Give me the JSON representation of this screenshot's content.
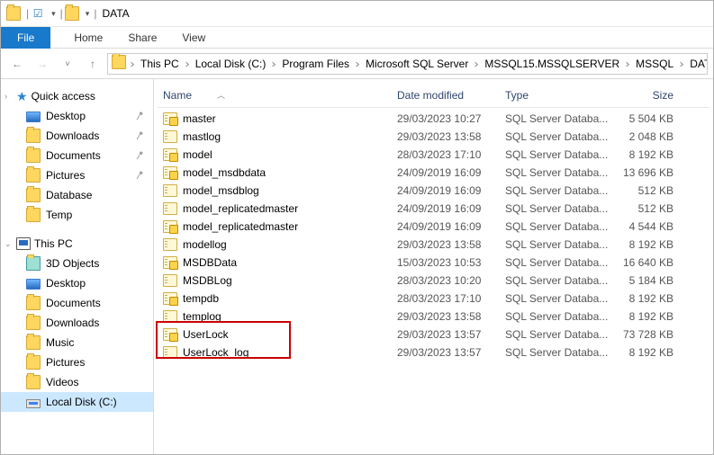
{
  "titlebar": {
    "title": "DATA"
  },
  "ribbon": {
    "file": "File",
    "tabs": [
      "Home",
      "Share",
      "View"
    ]
  },
  "breadcrumb": [
    "This PC",
    "Local Disk (C:)",
    "Program Files",
    "Microsoft SQL Server",
    "MSSQL15.MSSQLSERVER",
    "MSSQL",
    "DATA"
  ],
  "sidebar": {
    "quick": {
      "label": "Quick access"
    },
    "quick_items": [
      {
        "label": "Desktop",
        "pin": true,
        "icon": "desktop"
      },
      {
        "label": "Downloads",
        "pin": true,
        "icon": "folder"
      },
      {
        "label": "Documents",
        "pin": true,
        "icon": "folder"
      },
      {
        "label": "Pictures",
        "pin": true,
        "icon": "folder"
      },
      {
        "label": "Database",
        "pin": false,
        "icon": "folder"
      },
      {
        "label": "Temp",
        "pin": false,
        "icon": "folder"
      }
    ],
    "thispc": {
      "label": "This PC"
    },
    "pc_items": [
      {
        "label": "3D Objects",
        "icon": "folder3d"
      },
      {
        "label": "Desktop",
        "icon": "desktop"
      },
      {
        "label": "Documents",
        "icon": "folder"
      },
      {
        "label": "Downloads",
        "icon": "folder"
      },
      {
        "label": "Music",
        "icon": "folder"
      },
      {
        "label": "Pictures",
        "icon": "folder"
      },
      {
        "label": "Videos",
        "icon": "folder"
      },
      {
        "label": "Local Disk (C:)",
        "icon": "drive",
        "selected": true
      }
    ]
  },
  "columns": {
    "name": "Name",
    "date": "Date modified",
    "type": "Type",
    "size": "Size"
  },
  "files": [
    {
      "name": "master",
      "date": "29/03/2023 10:27",
      "type": "SQL Server Databa...",
      "size": "5 504 KB",
      "primary": true
    },
    {
      "name": "mastlog",
      "date": "29/03/2023 13:58",
      "type": "SQL Server Databa...",
      "size": "2 048 KB",
      "primary": false
    },
    {
      "name": "model",
      "date": "28/03/2023 17:10",
      "type": "SQL Server Databa...",
      "size": "8 192 KB",
      "primary": true
    },
    {
      "name": "model_msdbdata",
      "date": "24/09/2019 16:09",
      "type": "SQL Server Databa...",
      "size": "13 696 KB",
      "primary": true
    },
    {
      "name": "model_msdblog",
      "date": "24/09/2019 16:09",
      "type": "SQL Server Databa...",
      "size": "512 KB",
      "primary": false
    },
    {
      "name": "model_replicatedmaster",
      "date": "24/09/2019 16:09",
      "type": "SQL Server Databa...",
      "size": "512 KB",
      "primary": false
    },
    {
      "name": "model_replicatedmaster",
      "date": "24/09/2019 16:09",
      "type": "SQL Server Databa...",
      "size": "4 544 KB",
      "primary": true
    },
    {
      "name": "modellog",
      "date": "29/03/2023 13:58",
      "type": "SQL Server Databa...",
      "size": "8 192 KB",
      "primary": false
    },
    {
      "name": "MSDBData",
      "date": "15/03/2023 10:53",
      "type": "SQL Server Databa...",
      "size": "16 640 KB",
      "primary": true
    },
    {
      "name": "MSDBLog",
      "date": "28/03/2023 10:20",
      "type": "SQL Server Databa...",
      "size": "5 184 KB",
      "primary": false
    },
    {
      "name": "tempdb",
      "date": "28/03/2023 17:10",
      "type": "SQL Server Databa...",
      "size": "8 192 KB",
      "primary": true
    },
    {
      "name": "templog",
      "date": "29/03/2023 13:58",
      "type": "SQL Server Databa...",
      "size": "8 192 KB",
      "primary": false
    },
    {
      "name": "UserLock",
      "date": "29/03/2023 13:57",
      "type": "SQL Server Databa...",
      "size": "73 728 KB",
      "primary": true,
      "hl": true
    },
    {
      "name": "UserLock_log",
      "date": "29/03/2023 13:57",
      "type": "SQL Server Databa...",
      "size": "8 192 KB",
      "primary": false,
      "hl": true
    }
  ]
}
